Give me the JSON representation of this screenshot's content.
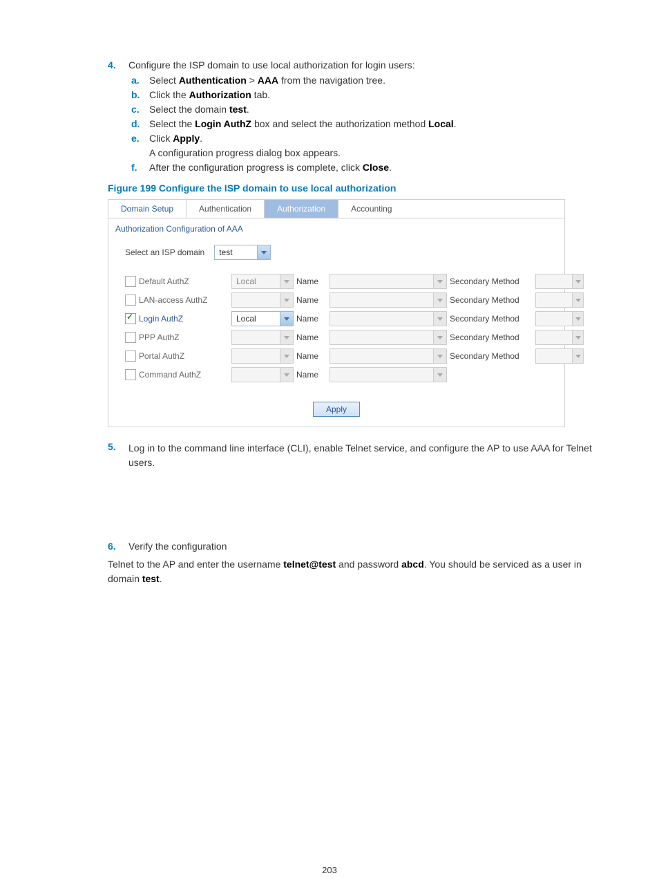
{
  "step4": {
    "num": "4.",
    "text": "Configure the ISP domain to use local authorization for login users:",
    "a": {
      "num": "a.",
      "pre": "Select ",
      "b1": "Authentication",
      "gt": " > ",
      "b2": "AAA",
      "post": " from the navigation tree."
    },
    "b": {
      "num": "b.",
      "pre": "Click the ",
      "b1": "Authorization",
      "post": " tab."
    },
    "c": {
      "num": "c.",
      "pre": "Select the domain ",
      "b1": "test",
      "post": "."
    },
    "d": {
      "num": "d.",
      "pre": "Select the ",
      "b1": "Login AuthZ",
      "mid": " box and select the authorization method ",
      "b2": "Local",
      "post": "."
    },
    "e": {
      "num": "e.",
      "pre": "Click ",
      "b1": "Apply",
      "post": ".",
      "extra": "A configuration progress dialog box appears."
    },
    "f": {
      "num": "f.",
      "pre": "After the configuration progress is complete, click ",
      "b1": "Close",
      "post": "."
    }
  },
  "figure_caption": "Figure 199 Configure the ISP domain to use local authorization",
  "ui": {
    "tabs": [
      "Domain Setup",
      "Authentication",
      "Authorization",
      "Accounting"
    ],
    "active_tab_index": 2,
    "section_title": "Authorization Configuration of AAA",
    "select_label": "Select an ISP domain",
    "select_value": "test",
    "cols": {
      "name": "Name",
      "sec": "Secondary Method"
    },
    "rows": [
      {
        "label": "Default AuthZ",
        "checked": false,
        "gray": true,
        "method": "Local",
        "method_disabled": true,
        "has_sec": true
      },
      {
        "label": "LAN-access AuthZ",
        "checked": false,
        "gray": true,
        "method": "",
        "method_disabled": true,
        "has_sec": true
      },
      {
        "label": "Login AuthZ",
        "checked": true,
        "gray": false,
        "method": "Local",
        "method_disabled": false,
        "has_sec": true
      },
      {
        "label": "PPP AuthZ",
        "checked": false,
        "gray": true,
        "method": "",
        "method_disabled": true,
        "has_sec": true
      },
      {
        "label": "Portal AuthZ",
        "checked": false,
        "gray": true,
        "method": "",
        "method_disabled": true,
        "has_sec": true
      },
      {
        "label": "Command AuthZ",
        "checked": false,
        "gray": true,
        "method": "",
        "method_disabled": true,
        "has_sec": false
      }
    ],
    "apply": "Apply"
  },
  "step5": {
    "num": "5.",
    "text": "Log in to the command line interface (CLI), enable Telnet service, and configure the AP to use AAA for Telnet users."
  },
  "step6": {
    "num": "6.",
    "text": "Verify the configuration"
  },
  "verify_para": {
    "pre": "Telnet to the AP and enter the username ",
    "b1": "telnet@test",
    "mid": " and password ",
    "b2": "abcd",
    "post": ". You should be serviced as a user in domain ",
    "b3": "test",
    "end": "."
  },
  "page_number": "203"
}
